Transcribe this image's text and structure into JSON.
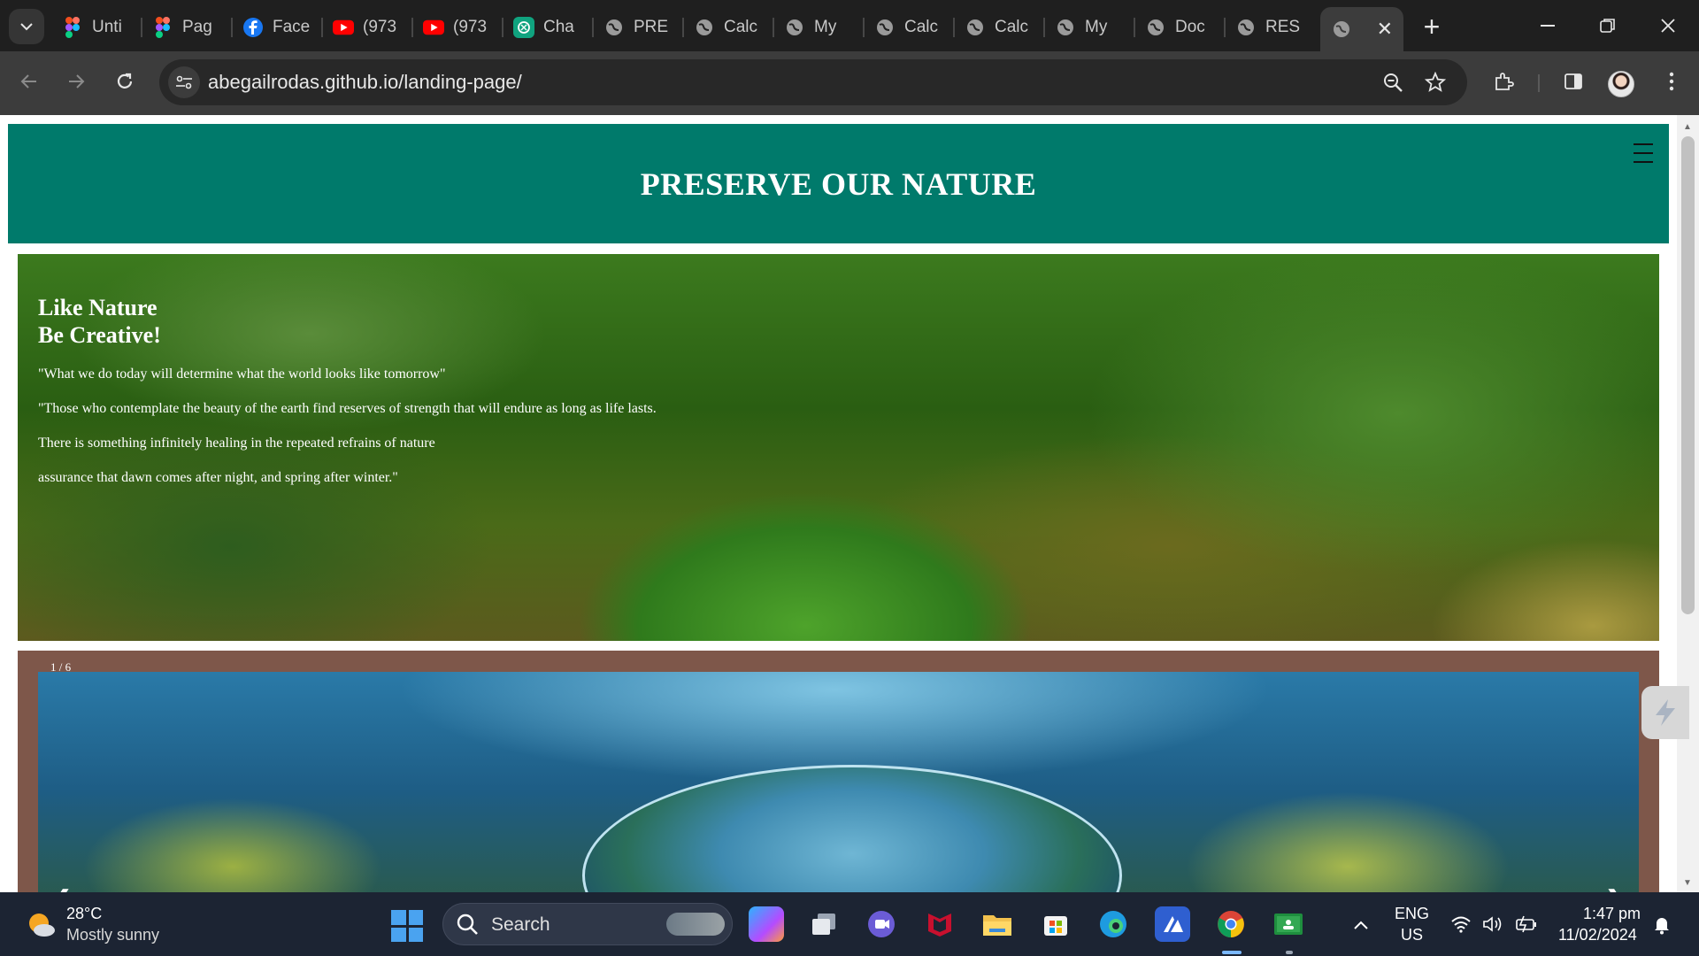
{
  "tabs": [
    {
      "title": "Unti",
      "icon": "figma-icon"
    },
    {
      "title": "Pag",
      "icon": "figma-icon"
    },
    {
      "title": "Face",
      "icon": "facebook-icon"
    },
    {
      "title": "(973",
      "icon": "youtube-icon"
    },
    {
      "title": "(973",
      "icon": "youtube-icon"
    },
    {
      "title": "Cha",
      "icon": "chatgpt-icon"
    },
    {
      "title": "PRE",
      "icon": "globe-icon"
    },
    {
      "title": "Calc",
      "icon": "globe-icon"
    },
    {
      "title": "My",
      "icon": "globe-icon"
    },
    {
      "title": "Calc",
      "icon": "globe-icon"
    },
    {
      "title": "Calc",
      "icon": "globe-icon"
    },
    {
      "title": "My",
      "icon": "globe-icon"
    },
    {
      "title": "Doc",
      "icon": "globe-icon"
    },
    {
      "title": "RES",
      "icon": "globe-icon"
    }
  ],
  "active_tab": {
    "icon": "globe-icon",
    "close": "✕"
  },
  "new_tab_label": "+",
  "toolbar": {
    "url": "abegailrodas.github.io/landing-page/"
  },
  "page": {
    "header_title": "PRESERVE OUR NATURE",
    "hero": {
      "heading_line1": "Like Nature",
      "heading_line2": "Be Creative!",
      "quotes": [
        "\"What we do today will determine what the world looks like tomorrow\"",
        "\"Those who contemplate the beauty of the earth find reserves of strength that will endure as long as life lasts.",
        "There is something infinitely healing in the repeated refrains of nature",
        "assurance that dawn comes after night, and spring after winter.\""
      ]
    },
    "slider": {
      "counter": "1 / 6",
      "prev": "❮",
      "next": "❯"
    }
  },
  "taskbar": {
    "weather_temp": "28°C",
    "weather_desc": "Mostly sunny",
    "search_label": "Search",
    "lang_line1": "ENG",
    "lang_line2": "US",
    "time": "1:47 pm",
    "date": "11/02/2024",
    "pinned_apps": [
      "copilot-icon",
      "task-view-icon",
      "teams-icon",
      "mcafee-icon",
      "file-explorer-icon",
      "microsoft-store-icon",
      "edge-icon",
      "azure-icon",
      "chrome-icon",
      "classroom-icon"
    ]
  },
  "colors": {
    "header_bg": "#007a6b",
    "slider_bg": "#7e574a",
    "browser_dark": "#3c3c3c",
    "taskbar_bg": "#1c2433"
  }
}
